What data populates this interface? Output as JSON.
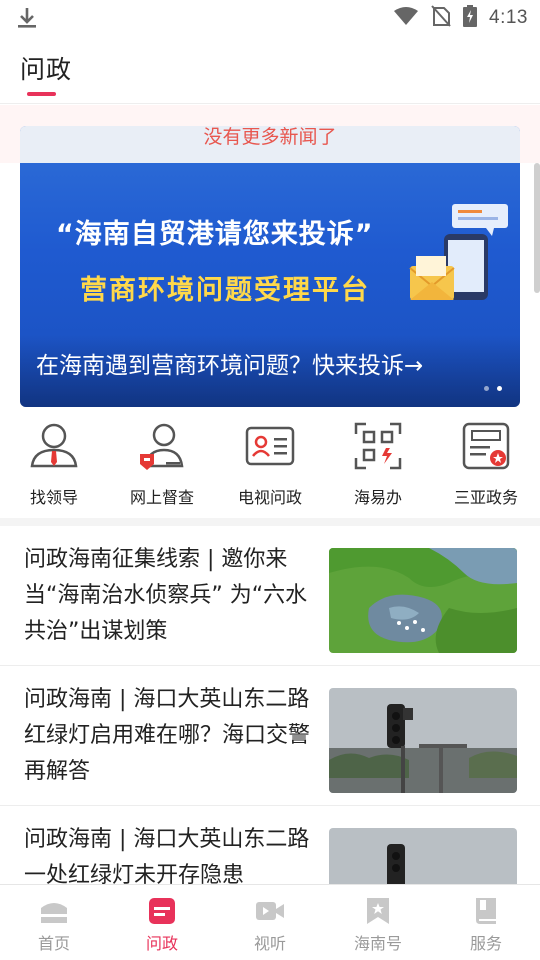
{
  "status_bar": {
    "time": "4:13"
  },
  "header": {
    "title": "问政"
  },
  "notice": {
    "text": "没有更多新闻了"
  },
  "banner": {
    "line1": "“海南自贸港请您来投诉”",
    "line2": "营商环境问题受理平台",
    "caption": "在海南遇到营商环境问题？快来投诉→",
    "page_count": 2,
    "active_page": 2
  },
  "entries": [
    {
      "label": "找领导",
      "icon": "leader-icon"
    },
    {
      "label": "网上督查",
      "icon": "supervise-icon"
    },
    {
      "label": "电视问政",
      "icon": "tv-card-icon"
    },
    {
      "label": "海易办",
      "icon": "qr-scan-icon"
    },
    {
      "label": "三亚政务",
      "icon": "sanya-gov-icon"
    }
  ],
  "news": [
    {
      "title": "问政海南征集线索 | 邀你来当“海南治水侦察兵” 为“六水共治”出谋划策",
      "thumb": "wetland-photo"
    },
    {
      "title": "问政海南 | 海口大英山东二路红绿灯启用难在哪？海口交警再解答",
      "thumb": "traffic-light-photo"
    },
    {
      "title": "问政海南 | 海口大英山东二路一处红绿灯未开存隐患",
      "thumb": "traffic-light-photo"
    }
  ],
  "bottom_nav": [
    {
      "label": "首页",
      "icon": "home-icon",
      "active": false
    },
    {
      "label": "问政",
      "icon": "wenzheng-icon",
      "active": true
    },
    {
      "label": "视听",
      "icon": "video-icon",
      "active": false
    },
    {
      "label": "海南号",
      "icon": "bookmark-icon",
      "active": false
    },
    {
      "label": "服务",
      "icon": "book-icon",
      "active": false
    }
  ],
  "colors": {
    "accent": "#e8325a",
    "notice": "#e8574f",
    "banner_blue": "#1f5ad0",
    "banner_yellow": "#ffd84a"
  }
}
